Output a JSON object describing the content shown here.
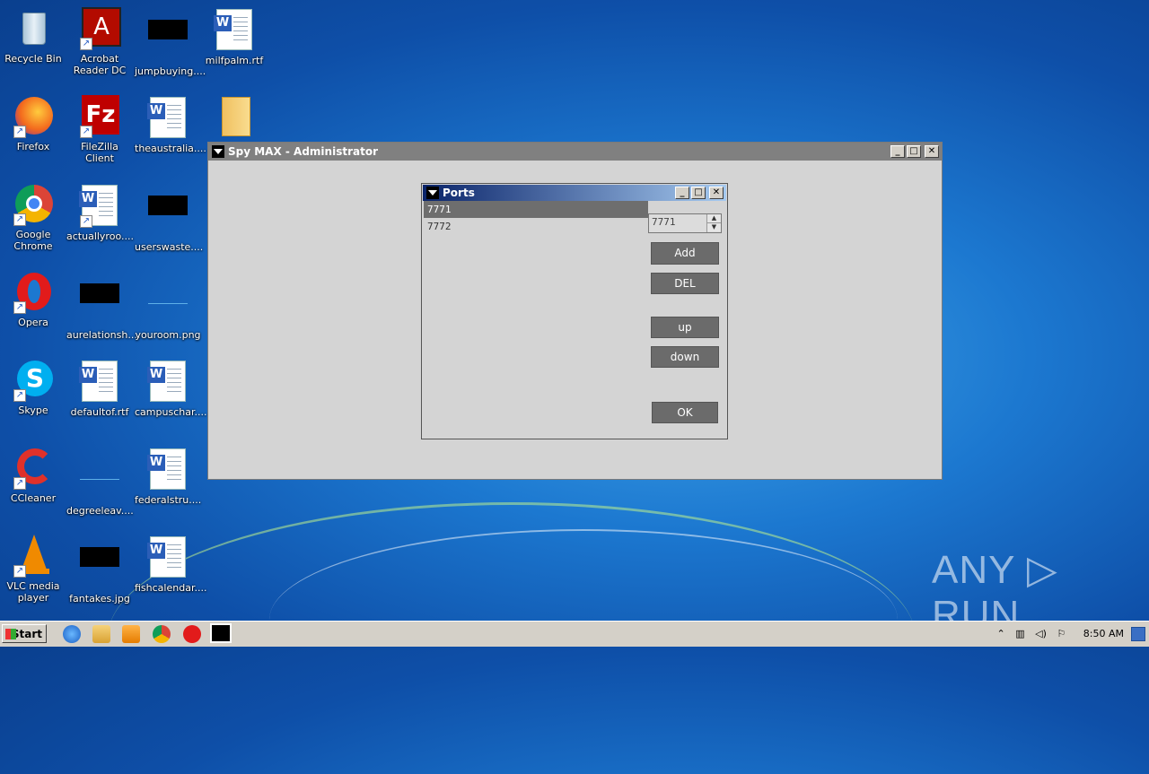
{
  "desktop": {
    "icons": [
      {
        "label": "Recycle Bin",
        "icon": "recycle-bin-icon"
      },
      {
        "label": "Acrobat Reader DC",
        "icon": "acrobat-icon"
      },
      {
        "label": "jumpbuying....",
        "icon": "redacted-file-icon"
      },
      {
        "label": "milfpalm.rtf",
        "icon": "word-doc-icon"
      },
      {
        "label": "Firefox",
        "icon": "firefox-icon"
      },
      {
        "label": "FileZilla Client",
        "icon": "filezilla-icon"
      },
      {
        "label": "theaustralia....",
        "icon": "word-doc-icon"
      },
      {
        "label": "",
        "icon": "folder-icon"
      },
      {
        "label": "Google Chrome",
        "icon": "chrome-icon"
      },
      {
        "label": "actuallyroo....",
        "icon": "word-doc-icon"
      },
      {
        "label": "userswaste....",
        "icon": "redacted-file-icon"
      },
      {
        "label": "Opera",
        "icon": "opera-icon"
      },
      {
        "label": "aurelationsh....",
        "icon": "redacted-file-icon"
      },
      {
        "label": "youroom.png",
        "icon": "image-file-icon"
      },
      {
        "label": "Skype",
        "icon": "skype-icon"
      },
      {
        "label": "defaultof.rtf",
        "icon": "word-doc-icon"
      },
      {
        "label": "campuschar....",
        "icon": "word-doc-icon"
      },
      {
        "label": "CCleaner",
        "icon": "ccleaner-icon"
      },
      {
        "label": "degreeleav....",
        "icon": "image-file-icon"
      },
      {
        "label": "federalstru....",
        "icon": "word-doc-icon"
      },
      {
        "label": "VLC media player",
        "icon": "vlc-icon"
      },
      {
        "label": "fantakes.jpg",
        "icon": "redacted-file-icon"
      },
      {
        "label": "fishcalendar....",
        "icon": "word-doc-icon"
      }
    ]
  },
  "main_window": {
    "title": "Spy MAX - Administrator",
    "controls": {
      "minimize": "_",
      "maximize": "□",
      "close": "✕"
    }
  },
  "ports_dialog": {
    "title": "Ports",
    "controls": {
      "minimize": "_",
      "maximize": "□",
      "close": "✕"
    },
    "ports": [
      "7771",
      "7772"
    ],
    "selected_index": 0,
    "spin_value": "7771",
    "buttons": {
      "add": "Add",
      "del": "DEL",
      "up": "up",
      "down": "down",
      "ok": "OK"
    }
  },
  "taskbar": {
    "start_label": "Start",
    "clock": "8:50 AM"
  },
  "watermark": "ANY ▷ RUN",
  "colors": {
    "ports_title_gradient_start": "#0a246a",
    "ports_title_gradient_end": "#a6caf0",
    "main_title_bg": "#808080",
    "button_bg": "#6b6b6b"
  }
}
